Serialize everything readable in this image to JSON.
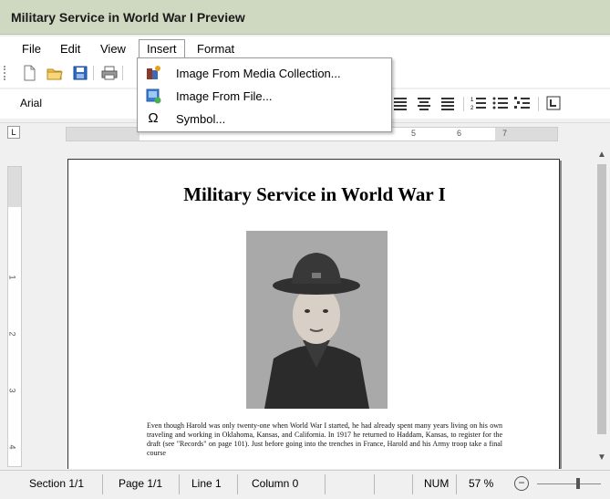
{
  "window": {
    "title": "Military Service in World War I Preview"
  },
  "menu": {
    "file": "File",
    "edit": "Edit",
    "view": "View",
    "insert": "Insert",
    "format": "Format"
  },
  "insert_menu": {
    "items": [
      {
        "label": "Image From Media Collection...",
        "icon": "media-collection-icon"
      },
      {
        "label": "Image From File...",
        "icon": "image-file-icon"
      },
      {
        "label": "Symbol...",
        "icon": "omega-icon"
      }
    ]
  },
  "format_toolbar": {
    "font": "Arial"
  },
  "ruler": {
    "h_numbers": [
      "5",
      "6",
      "7"
    ],
    "v_numbers": [
      "1",
      "2",
      "3",
      "4"
    ]
  },
  "document": {
    "title": "Military Service in World War I",
    "body": "Even though Harold was only twenty-one when World War I started, he had already spent many years living on his own traveling and working in Oklahoma, Kansas, and California. In 1917 he returned to Haddam, Kansas, to register for the draft (see \"Records\" on page 101). Just before going into the trenches in France, Harold and his Army troop take a final course"
  },
  "status": {
    "section": "Section 1/1",
    "page": "Page 1/1",
    "line": "Line 1",
    "column": "Column 0",
    "num": "NUM",
    "zoom": "57 %"
  },
  "colors": {
    "titlebar": "#cfd8c1",
    "accent": "#1f6fc4"
  }
}
